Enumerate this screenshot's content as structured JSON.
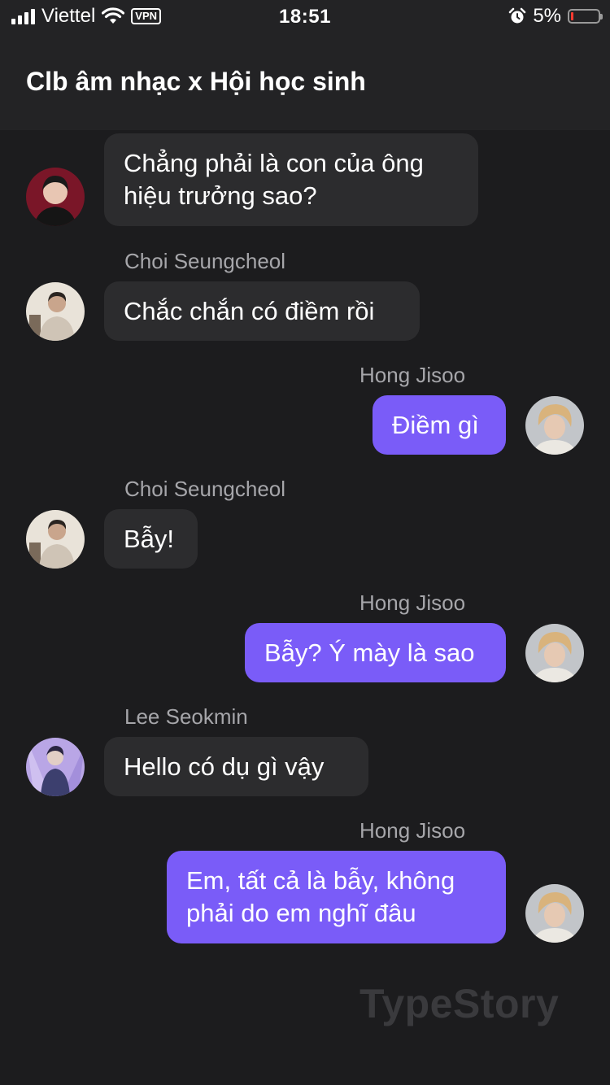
{
  "status_bar": {
    "carrier": "Viettel",
    "vpn": "VPN",
    "time": "18:51",
    "battery_text": "5%",
    "battery_level": 0.05,
    "icons": [
      "signal-icon",
      "wifi-icon",
      "alarm-icon",
      "battery-icon"
    ]
  },
  "header": {
    "title": "Clb âm nhạc x Hội học sinh"
  },
  "messages": [
    {
      "sender": "",
      "text": "Chẳng phải là con của ông\nhiệu trưởng sao?",
      "direction": "incoming"
    },
    {
      "sender": "Choi Seungcheol",
      "text": "Chắc chắn có điềm rồi",
      "direction": "incoming"
    },
    {
      "sender": "Hong Jisoo",
      "text": "Điềm gì",
      "direction": "outgoing"
    },
    {
      "sender": "Choi Seungcheol",
      "text": "Bẫy!",
      "direction": "incoming"
    },
    {
      "sender": "Hong Jisoo",
      "text": "Bẫy? Ý mày là sao",
      "direction": "outgoing"
    },
    {
      "sender": "Lee Seokmin",
      "text": "Hello có dụ gì vậy",
      "direction": "incoming"
    },
    {
      "sender": "Hong Jisoo",
      "text": "Em, tất cả là bẫy, không\nphải do em nghĩ đâu",
      "direction": "outgoing"
    }
  ],
  "watermark": "TypeStory",
  "colors": {
    "background": "#1c1c1e",
    "header": "#232325",
    "incoming_bubble": "#2c2c2e",
    "outgoing_bubble": "#7a5cf8",
    "sender_name": "#a6a6aa"
  }
}
